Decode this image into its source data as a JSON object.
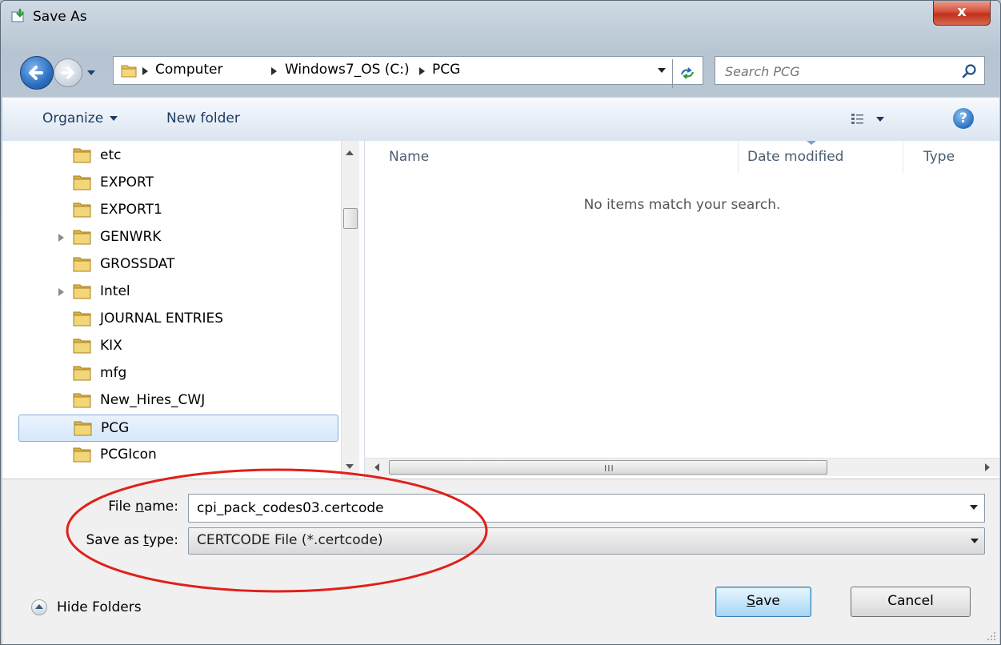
{
  "window": {
    "title": "Save As",
    "close_label": "x"
  },
  "address_bar": {
    "crumbs": [
      "Computer",
      "Windows7_OS (C:)",
      "PCG"
    ]
  },
  "search": {
    "placeholder": "Search PCG"
  },
  "toolbar": {
    "organize_label": "Organize",
    "new_folder_label": "New folder",
    "help_label": "?"
  },
  "folder_tree": {
    "items": [
      {
        "label": "etc",
        "expandable": false,
        "selected": false
      },
      {
        "label": "EXPORT",
        "expandable": false,
        "selected": false
      },
      {
        "label": "EXPORT1",
        "expandable": false,
        "selected": false
      },
      {
        "label": "GENWRK",
        "expandable": true,
        "selected": false
      },
      {
        "label": "GROSSDAT",
        "expandable": false,
        "selected": false
      },
      {
        "label": "Intel",
        "expandable": true,
        "selected": false
      },
      {
        "label": "JOURNAL ENTRIES",
        "expandable": false,
        "selected": false
      },
      {
        "label": "KIX",
        "expandable": false,
        "selected": false
      },
      {
        "label": "mfg",
        "expandable": false,
        "selected": false
      },
      {
        "label": "New_Hires_CWJ",
        "expandable": false,
        "selected": false
      },
      {
        "label": "PCG",
        "expandable": false,
        "selected": true
      },
      {
        "label": "PCGIcon",
        "expandable": false,
        "selected": false
      }
    ]
  },
  "file_list": {
    "columns": [
      "Name",
      "Date modified",
      "Type"
    ],
    "empty_message": "No items match your search.",
    "scroll_grip": "III"
  },
  "form": {
    "file_name_label_prefix": "File ",
    "file_name_label_key": "n",
    "file_name_label_suffix": "ame:",
    "file_name_value": "cpi_pack_codes03.certcode",
    "save_type_label_prefix": "Save as ",
    "save_type_label_key": "t",
    "save_type_label_suffix": "ype:",
    "save_type_value": "CERTCODE File (*.certcode)"
  },
  "footer": {
    "hide_folders_label": "Hide Folders",
    "save_key": "S",
    "save_rest": "ave",
    "cancel_label": "Cancel"
  },
  "colors": {
    "annotation": "#e0201a",
    "accent": "#2a6fc0"
  }
}
